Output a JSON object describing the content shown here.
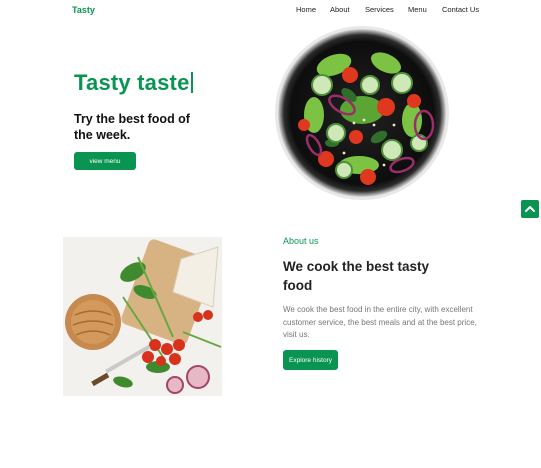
{
  "nav": {
    "logo": "Tasty",
    "links": [
      "Home",
      "About",
      "Services",
      "Menu",
      "Contact Us"
    ]
  },
  "hero": {
    "title": "Tasty taste",
    "subtitle": "Try the best food of the week.",
    "button": "view menu"
  },
  "about": {
    "label": "About us",
    "title": "We cook the best tasty food",
    "text": "We cook the best food in the entire city, with excellent customer service, the best meals and at the best price, visit us.",
    "button": "Explore history"
  },
  "icons": {
    "scroll_top": "chevron-up-icon"
  },
  "colors": {
    "accent": "#0a9452",
    "text_dark": "#222222",
    "text_muted": "#777777"
  }
}
